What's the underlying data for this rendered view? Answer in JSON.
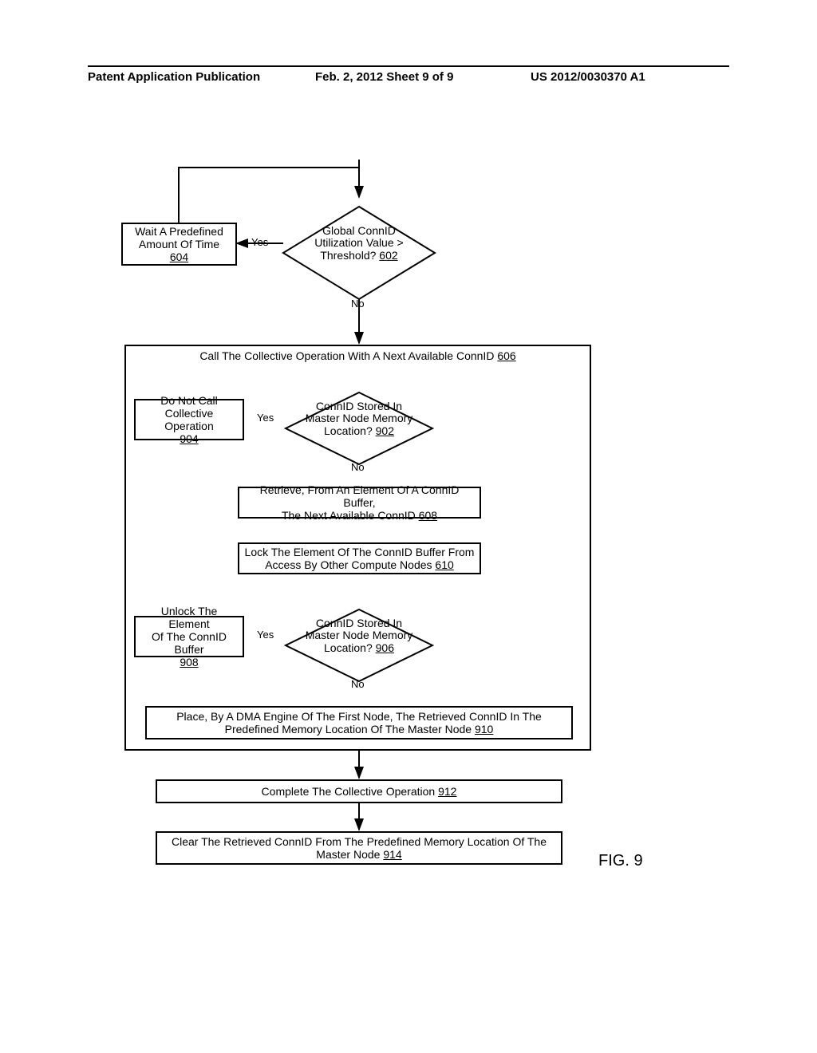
{
  "header": {
    "left": "Patent Application Publication",
    "mid": "Feb. 2, 2012  Sheet 9 of 9",
    "right": "US 2012/0030370 A1"
  },
  "figure_label": "FIG. 9",
  "labels": {
    "yes": "Yes",
    "no": "No"
  },
  "nodes": {
    "d602": {
      "lines": [
        "Global ConnID",
        "Utilization Value >",
        "Threshold?"
      ],
      "ref": "602"
    },
    "b604": {
      "lines": [
        "Wait A Predefined",
        "Amount Of Time"
      ],
      "ref": "604"
    },
    "b606_title": {
      "text": "Call The Collective Operation With A Next Available ConnID",
      "ref": "606"
    },
    "d902": {
      "lines": [
        "ConnID Stored In",
        "Master Node Memory",
        "Location?"
      ],
      "ref": "902"
    },
    "b904": {
      "lines": [
        "Do Not Call Collective",
        "Operation"
      ],
      "ref": "904"
    },
    "b608": {
      "lines": [
        "Retrieve, From An Element Of A ConnID Buffer,",
        "The Next Available ConnID"
      ],
      "ref": "608"
    },
    "b610": {
      "lines": [
        "Lock The Element Of The ConnID Buffer From",
        "Access By Other Compute Nodes"
      ],
      "ref": "610"
    },
    "d906": {
      "lines": [
        "ConnID Stored In",
        "Master Node Memory",
        "Location?"
      ],
      "ref": "906"
    },
    "b908": {
      "lines": [
        "Unlock The Element",
        "Of The ConnID Buffer"
      ],
      "ref": "908"
    },
    "b910": {
      "lines": [
        "Place, By A DMA Engine Of The First Node, The Retrieved ConnID In The",
        "Predefined Memory Location Of The Master Node"
      ],
      "ref": "910"
    },
    "b912": {
      "lines": [
        "Complete The Collective Operation"
      ],
      "ref": "912"
    },
    "b914": {
      "lines": [
        "Clear The Retrieved ConnID From The Predefined Memory Location Of The",
        "Master Node"
      ],
      "ref": "914"
    }
  },
  "chart_data": {
    "type": "flowchart",
    "nodes": [
      {
        "id": "602",
        "type": "decision",
        "text": "Global ConnID Utilization Value > Threshold?"
      },
      {
        "id": "604",
        "type": "process",
        "text": "Wait A Predefined Amount Of Time"
      },
      {
        "id": "606",
        "type": "container",
        "text": "Call The Collective Operation With A Next Available ConnID"
      },
      {
        "id": "902",
        "type": "decision",
        "text": "ConnID Stored In Master Node Memory Location?"
      },
      {
        "id": "904",
        "type": "process",
        "text": "Do Not Call Collective Operation"
      },
      {
        "id": "608",
        "type": "process",
        "text": "Retrieve, From An Element Of A ConnID Buffer, The Next Available ConnID"
      },
      {
        "id": "610",
        "type": "process",
        "text": "Lock The Element Of The ConnID Buffer From Access By Other Compute Nodes"
      },
      {
        "id": "906",
        "type": "decision",
        "text": "ConnID Stored In Master Node Memory Location?"
      },
      {
        "id": "908",
        "type": "process",
        "text": "Unlock The Element Of The ConnID Buffer"
      },
      {
        "id": "910",
        "type": "process",
        "text": "Place, By A DMA Engine Of The First Node, The Retrieved ConnID In The Predefined Memory Location Of The Master Node"
      },
      {
        "id": "912",
        "type": "process",
        "text": "Complete The Collective Operation"
      },
      {
        "id": "914",
        "type": "process",
        "text": "Clear The Retrieved ConnID From The Predefined Memory Location Of The Master Node"
      }
    ],
    "edges": [
      {
        "from": "entry",
        "to": "602"
      },
      {
        "from": "602",
        "to": "604",
        "label": "Yes"
      },
      {
        "from": "604",
        "to": "602",
        "label": "loop back"
      },
      {
        "from": "602",
        "to": "606",
        "label": "No"
      },
      {
        "from": "606",
        "to": "902"
      },
      {
        "from": "902",
        "to": "904",
        "label": "Yes"
      },
      {
        "from": "902",
        "to": "608",
        "label": "No"
      },
      {
        "from": "608",
        "to": "610"
      },
      {
        "from": "610",
        "to": "906"
      },
      {
        "from": "906",
        "to": "908",
        "label": "Yes"
      },
      {
        "from": "908",
        "to": "904"
      },
      {
        "from": "906",
        "to": "910",
        "label": "No"
      },
      {
        "from": "910",
        "to": "912"
      },
      {
        "from": "912",
        "to": "914"
      }
    ]
  }
}
